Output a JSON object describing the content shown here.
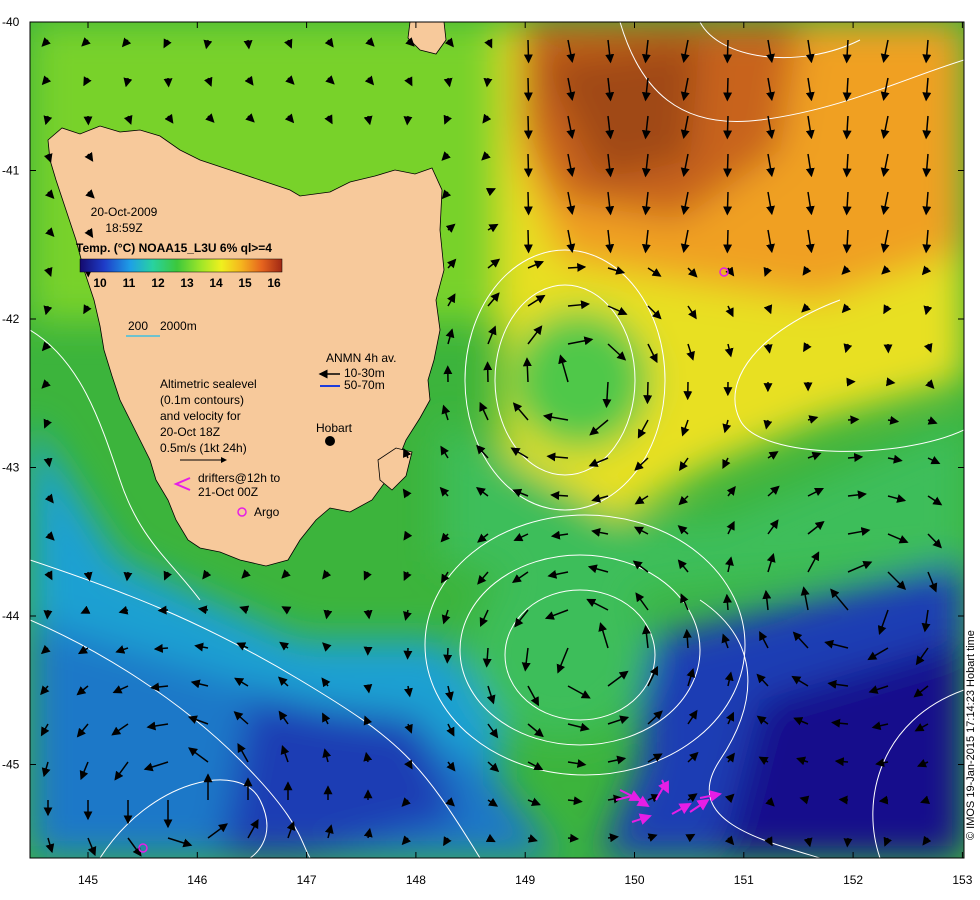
{
  "map": {
    "date": "20-Oct-2009",
    "time": "18:59Z",
    "colorbar_title": "Temp. (°C) NOAA15_L3U 6% ql>=4",
    "colorbar_ticks": [
      "10",
      "11",
      "12",
      "13",
      "14",
      "15",
      "16"
    ],
    "colorbar_colors": [
      "#140a6e",
      "#1e3cc8",
      "#1ea0e6",
      "#28d2a0",
      "#3cc83c",
      "#a0e628",
      "#f0f01e",
      "#f5b41e",
      "#e6641e",
      "#a02814"
    ],
    "isobath_label_200": "200",
    "isobath_label_2000": "2000m",
    "anmn_title": "ANMN 4h av.",
    "anmn_shallow": "10-30m",
    "anmn_deep": "50-70m",
    "anmn_shallow_color": "#000000",
    "anmn_deep_color": "#1e3cdc",
    "altimetry_lines": [
      "Altimetric sealevel",
      "(0.1m contours)",
      "and velocity for",
      "20-Oct 18Z",
      "0.5m/s (1kt 24h)"
    ],
    "drifters_lines": [
      "drifters@12h to",
      "21-Oct 00Z"
    ],
    "drifter_color": "#e61ee6",
    "argo_label": "Argo",
    "argo_color": "#e61ee6",
    "city_label": "Hobart",
    "land_color": "#f7c99b",
    "credit": "© IMOS 19-Jan-2015 17:14:23 Hobart time",
    "x_ticks": [
      "145",
      "146",
      "147",
      "148",
      "149",
      "150",
      "151",
      "152",
      "153"
    ],
    "y_ticks": [
      "-40",
      "-41",
      "-42",
      "-43",
      "-44",
      "-45"
    ]
  }
}
